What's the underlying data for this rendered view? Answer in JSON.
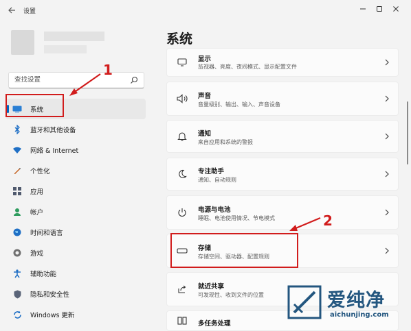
{
  "window": {
    "title": "设置"
  },
  "search": {
    "placeholder": "查找设置"
  },
  "sidebar": {
    "items": [
      {
        "label": "系统",
        "icon": "system-display-icon",
        "active": true
      },
      {
        "label": "蓝牙和其他设备",
        "icon": "bluetooth-icon"
      },
      {
        "label": "网络 & Internet",
        "icon": "wifi-icon"
      },
      {
        "label": "个性化",
        "icon": "pen-icon"
      },
      {
        "label": "应用",
        "icon": "apps-icon"
      },
      {
        "label": "帐户",
        "icon": "account-icon"
      },
      {
        "label": "时间和语言",
        "icon": "globe-icon"
      },
      {
        "label": "游戏",
        "icon": "gaming-icon"
      },
      {
        "label": "辅助功能",
        "icon": "accessibility-icon"
      },
      {
        "label": "隐私和安全性",
        "icon": "shield-icon"
      },
      {
        "label": "Windows 更新",
        "icon": "update-icon"
      }
    ]
  },
  "main": {
    "title": "系统",
    "cards": [
      {
        "title": "显示",
        "subtitle": "监视器、亮度、夜间模式、显示配置文件",
        "icon": "monitor-icon"
      },
      {
        "title": "声音",
        "subtitle": "音量级别、输出、输入、声音设备",
        "icon": "speaker-icon"
      },
      {
        "title": "通知",
        "subtitle": "来自应用和系统的警报",
        "icon": "bell-icon"
      },
      {
        "title": "专注助手",
        "subtitle": "通知、自动规则",
        "icon": "moon-icon"
      },
      {
        "title": "电源与电池",
        "subtitle": "睡眠、电池使用情况、节电模式",
        "icon": "power-icon"
      },
      {
        "title": "存储",
        "subtitle": "存储空间、驱动器、配置规则",
        "icon": "storage-icon"
      },
      {
        "title": "就近共享",
        "subtitle": "可发现性、收到文件的位置",
        "icon": "share-icon"
      },
      {
        "title": "多任务处理",
        "subtitle": "",
        "icon": "multitask-icon"
      }
    ]
  },
  "annotations": {
    "label_1": "1",
    "label_2": "2",
    "color": "#d11c1c"
  },
  "watermark": {
    "text": "爱纯净",
    "url": "aichunjing.com"
  },
  "colors": {
    "accent": "#0067c0",
    "background": "#f3f3f3",
    "card": "#fbfbfb"
  }
}
